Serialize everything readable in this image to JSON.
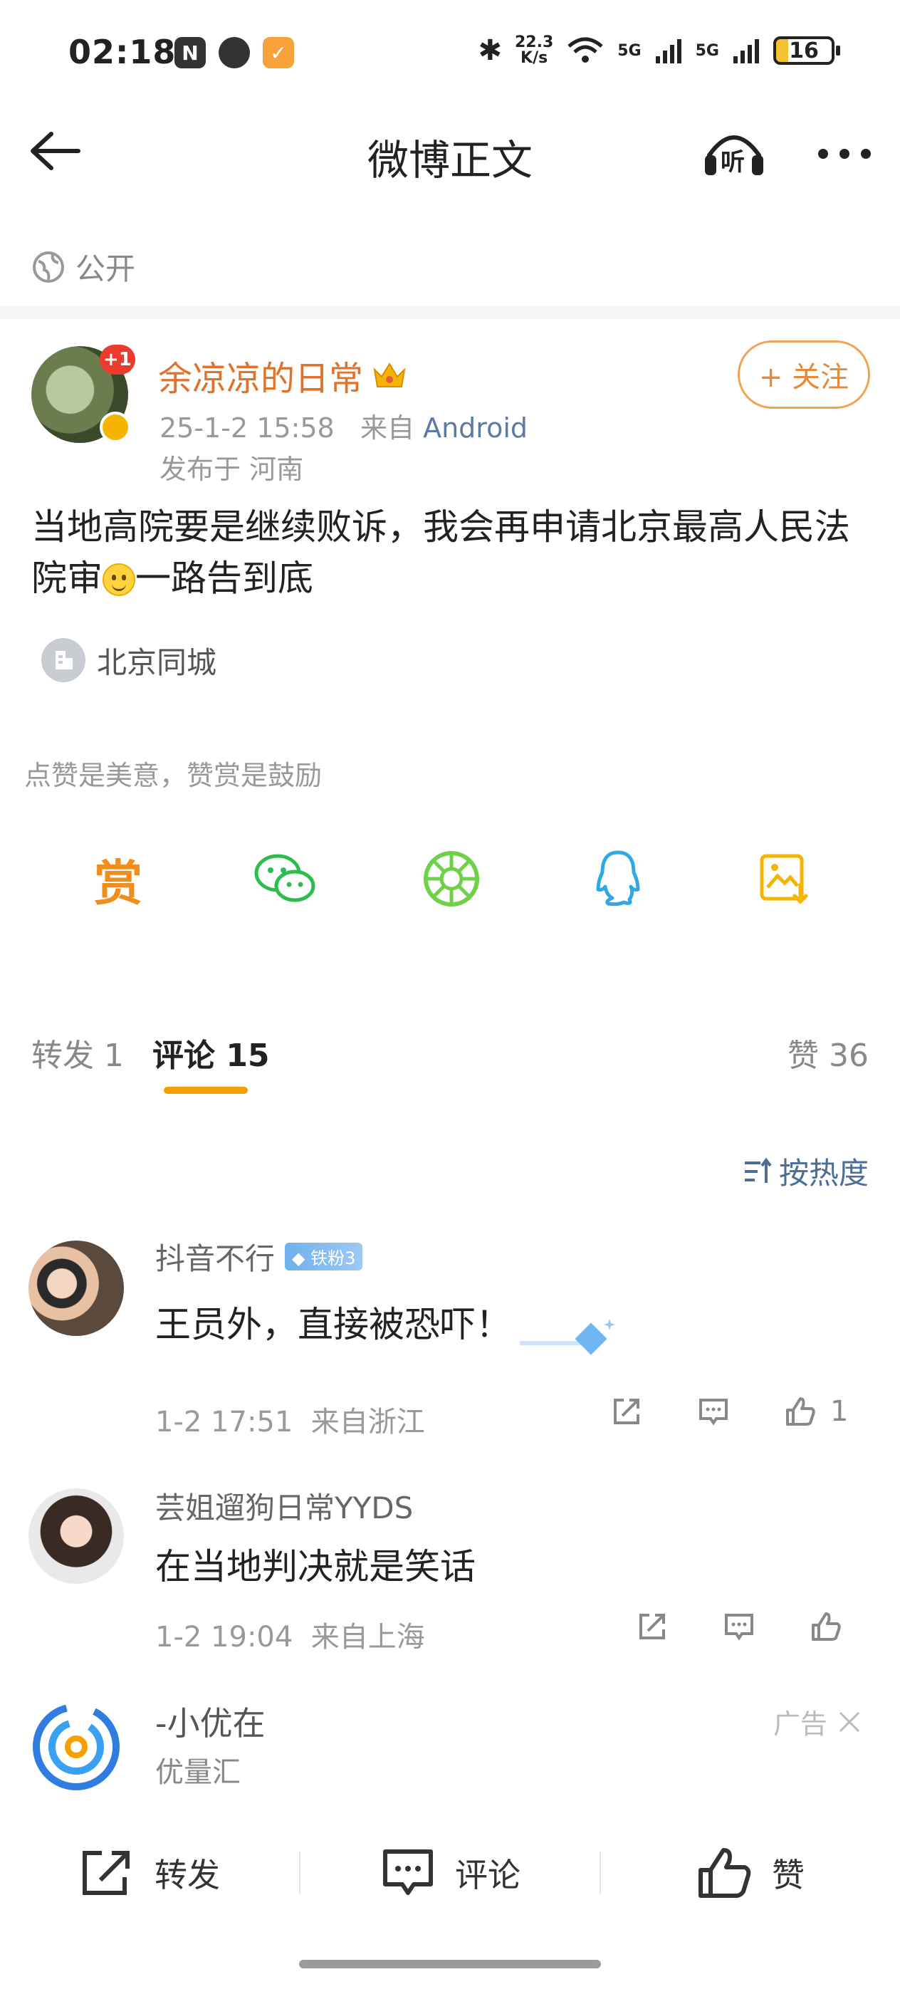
{
  "status_bar": {
    "time": "02:18",
    "speed": "22.3",
    "speed_unit": "K/s",
    "net1": "5G",
    "net2": "5G",
    "battery": "16"
  },
  "nav": {
    "title": "微博正文",
    "listen_label": "听"
  },
  "visibility": "公开",
  "post": {
    "author": "余凉凉的日常",
    "avatar_badge": "+1",
    "date": "25-1-2 15:58",
    "source_prefix": "来自",
    "source": "Android",
    "location_prefix": "发布于",
    "region": "河南",
    "follow_label": "+ 关注",
    "text_before_emoji": "当地高院要是继续败诉，我会再申请北京最高人民法院审",
    "text_after_emoji": "一路告到底",
    "location_tag": "北京同城"
  },
  "like_hint": "点赞是美意，赞赏是鼓励",
  "reward_glyph": "赏",
  "tabs": {
    "repost": "转发 1",
    "comment": "评论 15",
    "like": "赞 36"
  },
  "sort_label": "按热度",
  "comments": [
    {
      "name": "抖音不行",
      "badge": "铁粉3",
      "text": "王员外，直接被恐吓！",
      "time": "1-2 17:51",
      "location": "来自浙江",
      "likes": "1"
    },
    {
      "name": "芸姐遛狗日常YYDS",
      "badge": "",
      "text": "在当地判决就是笑话",
      "time": "1-2 19:04",
      "location": "来自上海",
      "likes": ""
    }
  ],
  "ad": {
    "name": "-小优在",
    "sub": "优量汇",
    "tag": "广告"
  },
  "toolbar": {
    "repost": "转发",
    "comment": "评论",
    "like": "赞"
  },
  "colors": {
    "author": "#e0722c",
    "accent": "#f5a000",
    "link": "#4c6e95",
    "wechat": "#2fbc4f",
    "moments": "#6fd14a",
    "qq": "#2fa9e6",
    "save": "#f5b400"
  }
}
